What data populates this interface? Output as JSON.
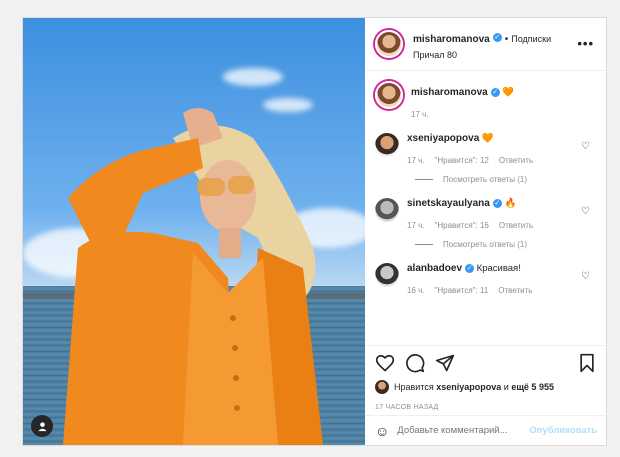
{
  "header": {
    "username": "misharomanova",
    "follow_label": "Подписки",
    "location": "Причал 80",
    "more": "•••"
  },
  "caption": {
    "username": "misharomanova",
    "emoji": "🧡",
    "time": "17 ч."
  },
  "comments": [
    {
      "username": "xseniyapopova",
      "text": "🧡",
      "time": "17 ч.",
      "likes": "\"Нравится\": 12",
      "reply": "Ответить",
      "replies": "Посмотреть ответы (1)"
    },
    {
      "username": "sinetskayaulyana",
      "text": "🔥",
      "time": "17 ч.",
      "likes": "\"Нравится\": 16",
      "reply": "Ответить",
      "replies": "Посмотреть ответы (1)"
    },
    {
      "username": "alanbadoev",
      "text": "Красивая!",
      "time": "16 ч.",
      "likes": "\"Нравится\": 11",
      "reply": "Ответить",
      "replies": ""
    }
  ],
  "likes": {
    "prefix": "Нравится",
    "user": "xseniyapopova",
    "middle": "и",
    "count": "ещё 5 955"
  },
  "timestamp": "17 ЧАСОВ НАЗАД",
  "add_comment": {
    "placeholder": "Добавьте комментарий...",
    "publish": "Опубликовать"
  },
  "colors": {
    "accent": "#3897f0",
    "publish_disabled": "#b2dffc",
    "outfit": "#f08a1e"
  },
  "icons": [
    "heart-icon",
    "comment-icon",
    "share-icon",
    "bookmark-icon",
    "user-tag-icon",
    "verified-icon"
  ]
}
